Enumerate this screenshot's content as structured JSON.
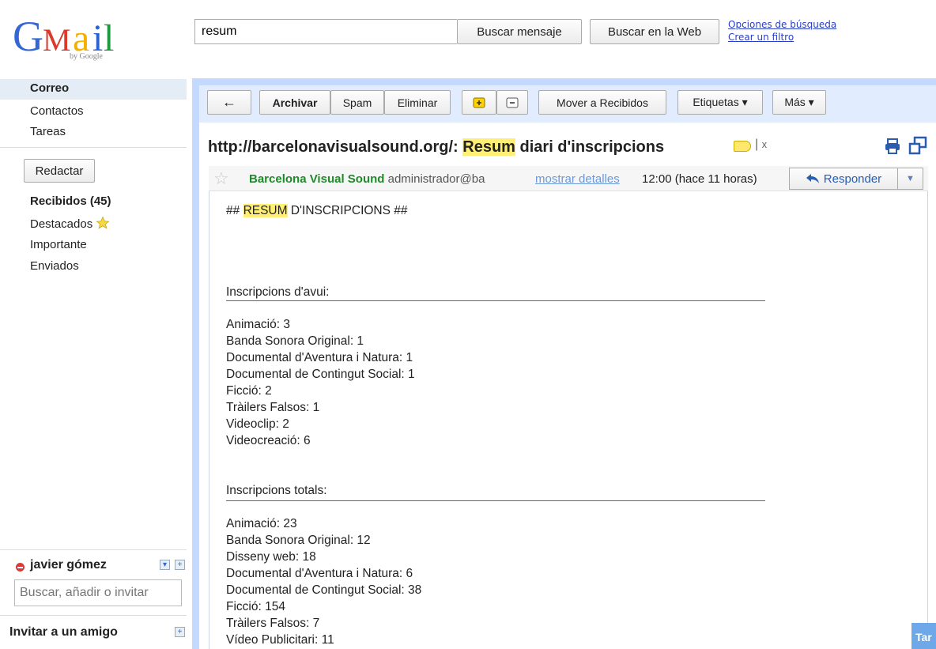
{
  "header": {
    "logo_text": "Gmail",
    "logo_sub": "by Google",
    "search_value": "resum",
    "search_mail_label": "Buscar mensaje",
    "search_web_label": "Buscar en la Web",
    "search_options_link": "Opciones de búsqueda",
    "create_filter_link": "Crear un filtro"
  },
  "nav": {
    "top_items": [
      "Correo",
      "Contactos",
      "Tareas"
    ],
    "compose_label": "Redactar",
    "folders": [
      "Recibidos (45)",
      "Destacados",
      "Importante",
      "Enviados"
    ]
  },
  "chat": {
    "user_name": "javier gómez",
    "search_placeholder": "Buscar, añadir o invitar",
    "invite_label": "Invitar a un amigo"
  },
  "toolbar": {
    "back_symbol": "←",
    "archive_label": "Archivar",
    "spam_label": "Spam",
    "delete_label": "Eliminar",
    "move_inbox_label": "Mover a Recibidos",
    "labels_label": "Etiquetas ▾",
    "more_label": "Más ▾"
  },
  "message": {
    "subject_prefix": "http://barcelonavisualsound.org/: ",
    "subject_highlight": "Resum",
    "subject_suffix": " diari d'inscripcions",
    "label_close": "x",
    "sender_name": "Barcelona Visual Sound",
    "sender_email": "administrador@ba",
    "show_details": "mostrar detalles",
    "time": "12:00 (hace 11 horas)",
    "reply_label": "Responder",
    "reply_dropdown": "▼",
    "body_intro_prefix": "## ",
    "body_intro_highlight": "RESUM",
    "body_intro_suffix": " D'INSCRIPCIONS ##",
    "today_heading": "Inscripcions d'avui:",
    "today_items": [
      "Animació: 3",
      "Banda Sonora Original: 1",
      "Documental d'Aventura i Natura: 1",
      "Documental de Contingut Social: 1",
      "Ficció: 2",
      "Tràilers Falsos: 1",
      "Videoclip: 2",
      "Videocreació: 6"
    ],
    "total_heading": "Inscripcions totals:",
    "total_items": [
      "Animació: 23",
      "Banda Sonora Original: 12",
      "Disseny web: 18",
      "Documental d'Aventura i Natura: 6",
      "Documental de Contingut Social: 38",
      "Ficció: 154",
      "Tràilers Falsos: 7",
      "Vídeo Publicitari: 11"
    ]
  },
  "corner_tab_label": "Tar"
}
